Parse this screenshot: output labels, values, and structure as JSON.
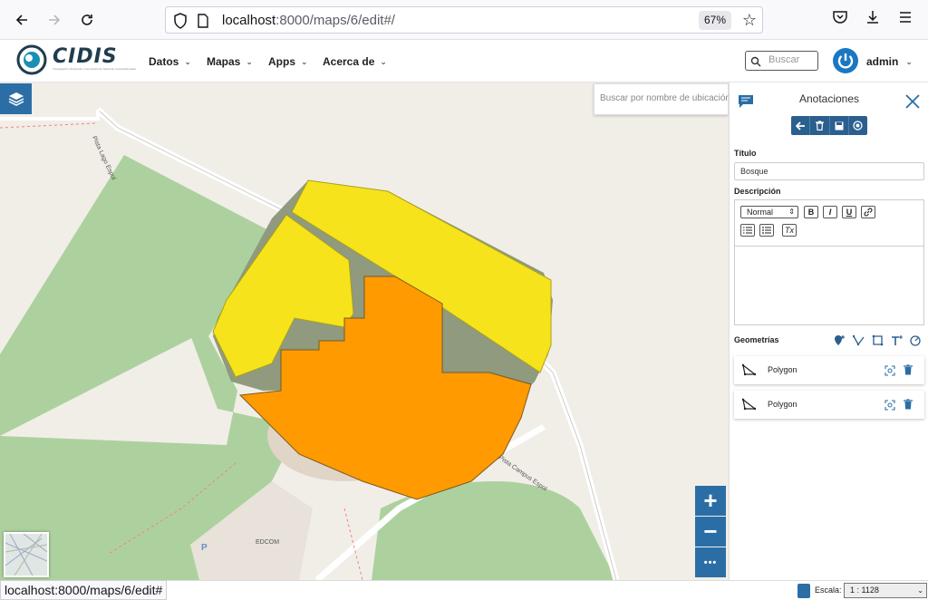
{
  "browser": {
    "url_host": "localhost",
    "url_path": ":8000/maps/6/edit#/",
    "zoom": "67%"
  },
  "header": {
    "logo_text": "CIDIS",
    "logo_subtitle": "Investigación, Desarrollo e Innovación de Sistemas Computacionales",
    "menu": [
      {
        "label": "Datos"
      },
      {
        "label": "Mapas"
      },
      {
        "label": "Apps"
      },
      {
        "label": "Acerca de"
      }
    ],
    "search_placeholder": "Buscar",
    "user": "admin"
  },
  "map": {
    "location_search_placeholder": "Buscar por nombre de ubicación",
    "labels": {
      "street_1": "Pista Lago Espol",
      "street_2": "Pista Campus Espol",
      "building": "EDCOM",
      "parking": "P"
    },
    "zoom_in": "+",
    "zoom_out": "−",
    "more": "•••"
  },
  "panel": {
    "title": "Anotaciones",
    "titulo_label": "Título",
    "titulo_value": "Bosque",
    "descripcion_label": "Descripción",
    "editor_format": "Normal",
    "editor_buttons": {
      "bold": "B",
      "italic": "I",
      "underline": "U",
      "clear": "Tx"
    },
    "geometrias_label": "Geometrías",
    "geometries": [
      {
        "name": "Polygon"
      },
      {
        "name": "Polygon"
      }
    ]
  },
  "status": {
    "hover_url": "localhost:8000/maps/6/edit#",
    "scale_label": "Escala:",
    "scale_value": "1 : 1128"
  },
  "colors": {
    "accent": "#2b6ea6",
    "polygon_yellow": "#f7e31b",
    "polygon_orange": "#ff9a00",
    "forest": "#add19e"
  }
}
